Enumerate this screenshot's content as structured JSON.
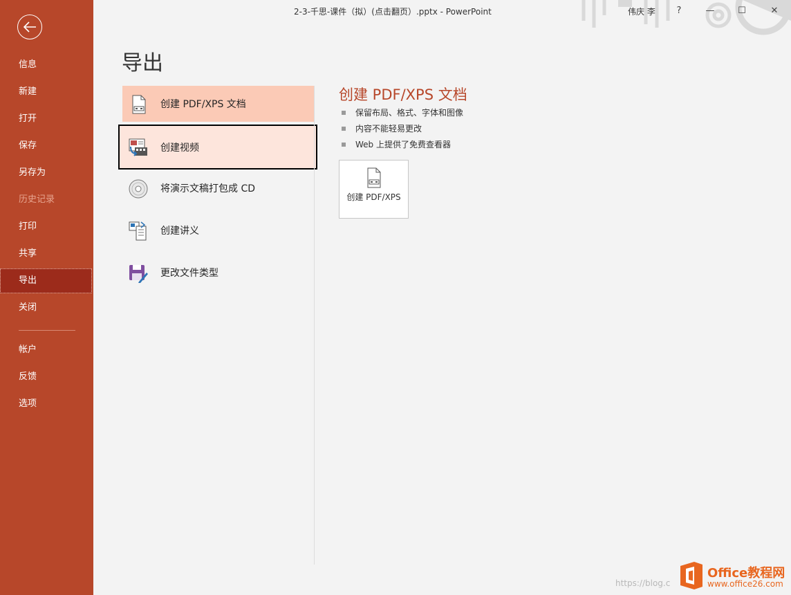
{
  "window": {
    "title": "2-3-千思-课件（拟）(点击翻页）.pptx  -  PowerPoint",
    "user": "伟庆 李",
    "help": "?",
    "minimize": "—",
    "maximize": "☐",
    "close": "✕"
  },
  "sidebar": {
    "items": [
      {
        "label": "信息"
      },
      {
        "label": "新建"
      },
      {
        "label": "打开"
      },
      {
        "label": "保存"
      },
      {
        "label": "另存为"
      },
      {
        "label": "历史记录"
      },
      {
        "label": "打印"
      },
      {
        "label": "共享"
      },
      {
        "label": "导出"
      },
      {
        "label": "关闭"
      },
      {
        "label": "帐户"
      },
      {
        "label": "反馈"
      },
      {
        "label": "选项"
      }
    ]
  },
  "page": {
    "title": "导出"
  },
  "options": [
    {
      "label": "创建 PDF/XPS 文档",
      "icon": "pdf-document-icon"
    },
    {
      "label": "创建视频",
      "icon": "video-icon"
    },
    {
      "label": "将演示文稿打包成 CD",
      "icon": "cd-icon"
    },
    {
      "label": "创建讲义",
      "icon": "handout-icon"
    },
    {
      "label": "更改文件类型",
      "icon": "save-file-type-icon"
    }
  ],
  "detail": {
    "title": "创建 PDF/XPS 文档",
    "bullets": [
      "保留布局、格式、字体和图像",
      "内容不能轻易更改",
      "Web 上提供了免费查看器"
    ],
    "button_label": "创建 PDF/XPS"
  },
  "watermark": {
    "url": "https://blog.c",
    "brand": "Office教程网",
    "site": "www.office26.com"
  },
  "colors": {
    "accent": "#b7472a",
    "selected": "#fbcab6",
    "hover": "#fde5dc"
  }
}
